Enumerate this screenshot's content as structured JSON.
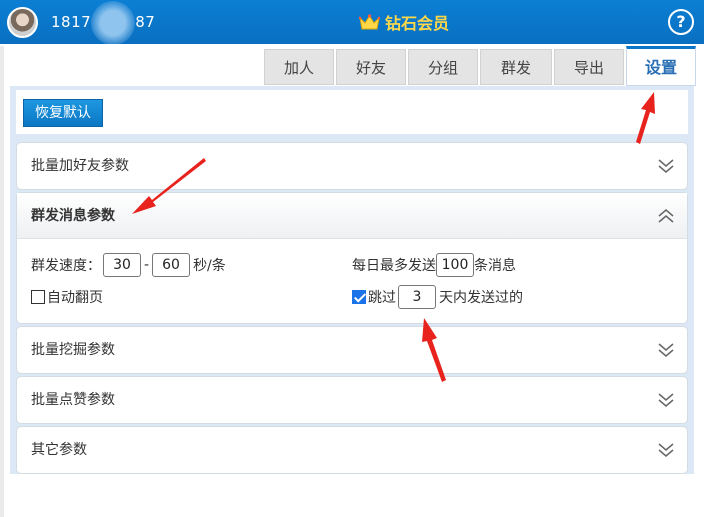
{
  "header": {
    "phone_prefix": "1817",
    "phone_suffix": "87",
    "vip_label": "钻石会员",
    "help_glyph": "?",
    "accent_color": "#0a75c9",
    "vip_color": "#ffd84a"
  },
  "tabs": [
    {
      "label": "加人",
      "active": false
    },
    {
      "label": "好友",
      "active": false
    },
    {
      "label": "分组",
      "active": false
    },
    {
      "label": "群发",
      "active": false
    },
    {
      "label": "导出",
      "active": false
    },
    {
      "label": "设置",
      "active": true
    }
  ],
  "toolbar": {
    "restore_label": "恢复默认"
  },
  "sections": [
    {
      "title": "批量加好友参数",
      "expanded": false
    },
    {
      "title": "群发消息参数",
      "expanded": true
    },
    {
      "title": "批量挖掘参数",
      "expanded": false
    },
    {
      "title": "批量点赞参数",
      "expanded": false
    },
    {
      "title": "其它参数",
      "expanded": false
    }
  ],
  "group_send": {
    "speed_label": "群发速度：",
    "speed_min": "30",
    "speed_sep": "-",
    "speed_max": "60",
    "speed_unit": "秒/条",
    "daily_label": "每日最多发送",
    "daily_value": "100",
    "daily_unit": "条消息",
    "auto_page_label": "自动翻页",
    "auto_page_checked": false,
    "skip_label": "跳过",
    "skip_value": "3",
    "skip_unit": "天内发送过的",
    "skip_checked": true
  },
  "icons": {
    "expand": "chevron-double-down-icon",
    "collapse": "chevron-double-up-icon",
    "vip": "crown-icon",
    "help": "help-circle-icon"
  }
}
